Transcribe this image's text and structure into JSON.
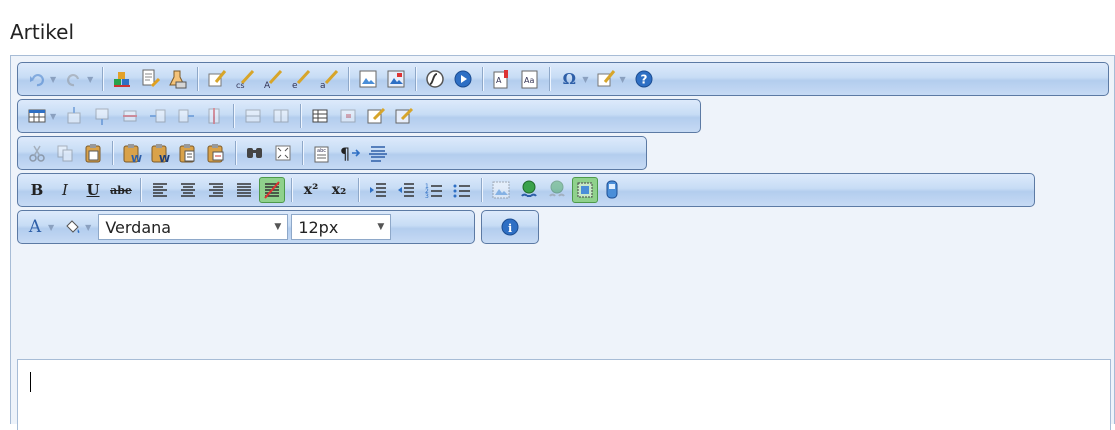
{
  "field": {
    "label": "Artikel"
  },
  "toolbar": {
    "font_family": {
      "selected": "Verdana"
    },
    "font_size": {
      "selected": "12px"
    },
    "text_buttons": {
      "bold": "B",
      "italic": "I",
      "underline": "U",
      "strikethrough": "abe",
      "superscript": "x²",
      "subscript": "x₂",
      "omega": "Ω",
      "font_color": "A"
    }
  },
  "editor": {
    "content": ""
  },
  "colors": {
    "toolbar_border": "#5c7aa4",
    "toolbar_bg_top": "#ddeafb",
    "toolbar_bg_bottom": "#b3cdee",
    "active_button": "#8fd18c"
  }
}
